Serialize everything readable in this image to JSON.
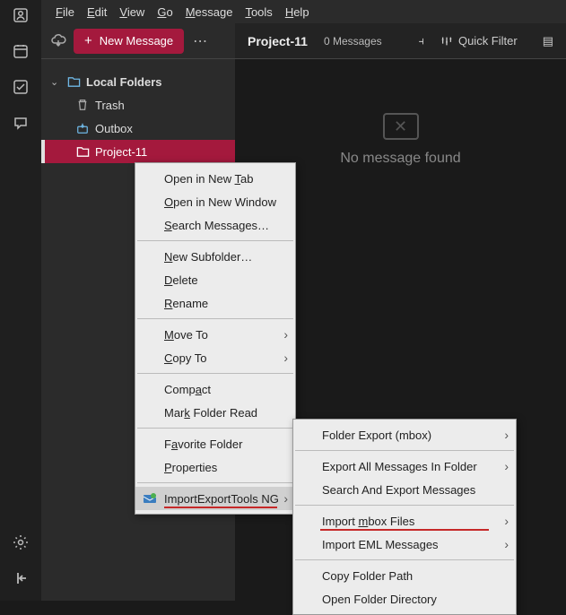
{
  "menubar": [
    "File",
    "Edit",
    "View",
    "Go",
    "Message",
    "Tools",
    "Help"
  ],
  "toolbar": {
    "new_message": "New Message"
  },
  "tree": {
    "root": "Local Folders",
    "trash": "Trash",
    "outbox": "Outbox",
    "selected": "Project-11"
  },
  "main": {
    "title": "Project-11",
    "count": "0 Messages",
    "quick_filter": "Quick Filter",
    "empty": "No message found"
  },
  "ctx": {
    "open_new_tab": "Open in New Tab",
    "open_new_window": "Open in New Window",
    "search_messages": "Search Messages…",
    "new_subfolder": "New Subfolder…",
    "delete": "Delete",
    "rename": "Rename",
    "move_to": "Move To",
    "copy_to": "Copy To",
    "compact": "Compact",
    "mark_read": "Mark Folder Read",
    "favorite": "Favorite Folder",
    "properties": "Properties",
    "ietng": "ImportExportTools NG"
  },
  "sub": {
    "folder_export": "Folder Export (mbox)",
    "export_all": "Export All Messages In Folder",
    "search_export": "Search And Export Messages",
    "import_mbox": "Import mbox Files",
    "import_eml": "Import EML Messages",
    "copy_path": "Copy Folder Path",
    "open_dir": "Open Folder Directory"
  }
}
